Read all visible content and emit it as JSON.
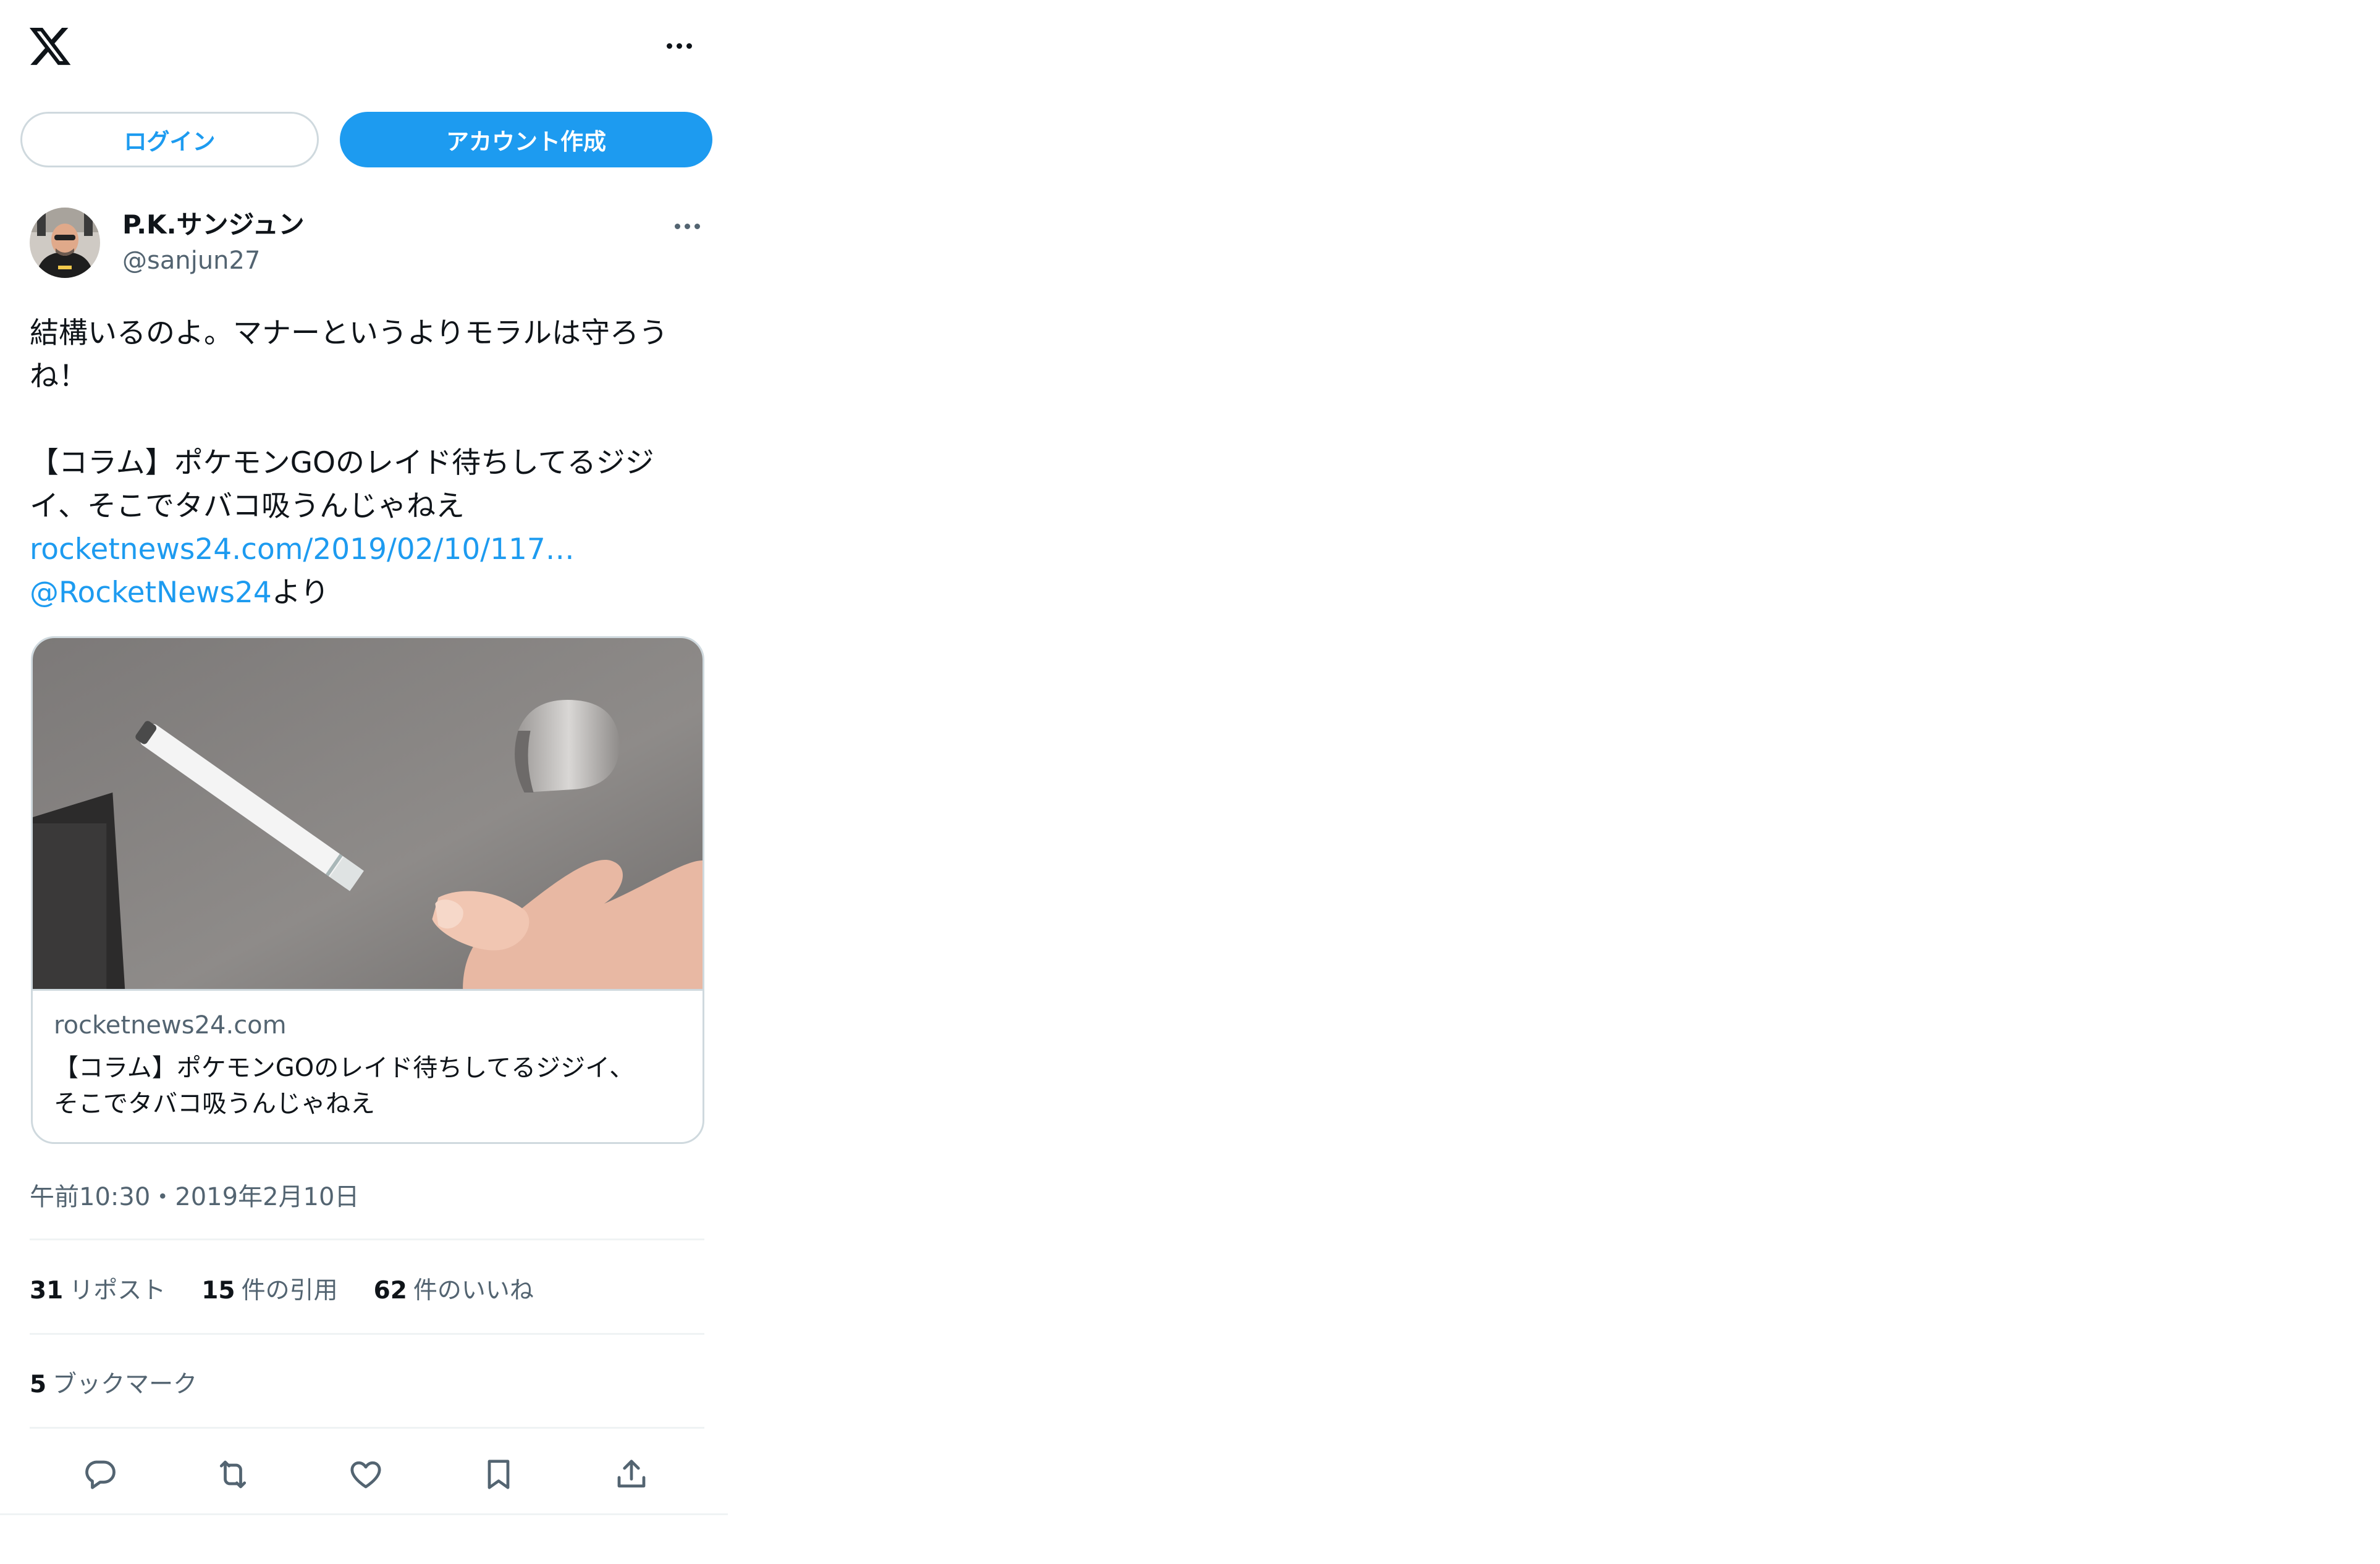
{
  "header": {
    "logo_icon": "x-logo-icon",
    "more_icon": "more-icon",
    "login_label": "ログイン",
    "signup_label": "アカウント作成"
  },
  "tweet": {
    "author_name": "P.K.サンジュン",
    "author_handle": "@sanjun27",
    "text_line1": "結構いるのよ。マナーというよりモラルは守ろう",
    "text_line2": "ね！",
    "text_line3": "【コラム】ポケモンGOのレイド待ちしてるジジ",
    "text_line4": "イ、そこでタバコ吸うんじゃねえ",
    "link_url": "rocketnews24.com/2019/02/10/117…",
    "mention": "@RocketNews24",
    "mention_suffix": "より",
    "card": {
      "domain": "rocketnews24.com",
      "title_line1": "【コラム】ポケモンGOのレイド待ちしてるジジイ、",
      "title_line2": "そこでタバコ吸うんじゃねえ"
    },
    "timestamp": "午前10:30・2019年2月10日",
    "stats": {
      "reposts_count": "31",
      "reposts_label": "リポスト",
      "quotes_count": "15",
      "quotes_label": "件の引用",
      "likes_count": "62",
      "likes_label": "件のいいね",
      "bookmarks_count": "5",
      "bookmarks_label": "ブックマーク"
    }
  },
  "actions": [
    "reply-icon",
    "repost-icon",
    "like-icon",
    "bookmark-icon",
    "share-icon"
  ],
  "colors": {
    "accent": "#1d9bf0",
    "text": "#0f1419",
    "secondary": "#536471",
    "border": "#cfd9de"
  }
}
